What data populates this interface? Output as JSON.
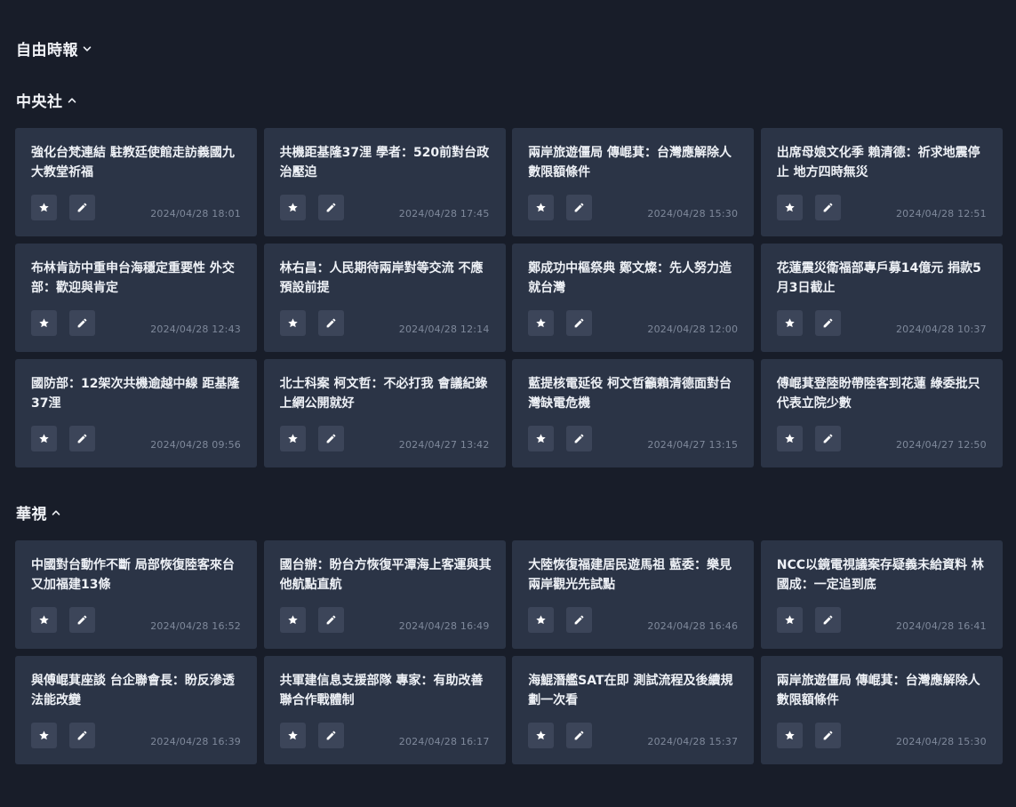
{
  "sections": [
    {
      "title": "自由時報",
      "expanded": false,
      "cards": []
    },
    {
      "title": "中央社",
      "expanded": true,
      "cards": [
        {
          "title": "強化台梵連結 駐教廷使館走訪義國九大教堂祈福",
          "time": "2024/04/28 18:01"
        },
        {
          "title": "共機距基隆37浬 學者：520前對台政治壓迫",
          "time": "2024/04/28 17:45"
        },
        {
          "title": "兩岸旅遊僵局 傳崐萁：台灣應解除人數限額條件",
          "time": "2024/04/28 15:30"
        },
        {
          "title": "出席母娘文化季 賴清德：祈求地震停止 地方四時無災",
          "time": "2024/04/28 12:51"
        },
        {
          "title": "布林肯訪中重申台海穩定重要性 外交部：歡迎與肯定",
          "time": "2024/04/28 12:43"
        },
        {
          "title": "林右昌：人民期待兩岸對等交流 不應預設前提",
          "time": "2024/04/28 12:14"
        },
        {
          "title": "鄭成功中樞祭典 鄭文燦：先人努力造就台灣",
          "time": "2024/04/28 12:00"
        },
        {
          "title": "花蓮震災衛福部專戶募14億元 捐款5月3日截止",
          "time": "2024/04/28 10:37"
        },
        {
          "title": "國防部：12架次共機逾越中線 距基隆37浬",
          "time": "2024/04/28 09:56"
        },
        {
          "title": "北士科案 柯文哲：不必打我 會議紀錄上網公開就好",
          "time": "2024/04/27 13:42"
        },
        {
          "title": "藍提核電延役 柯文哲籲賴清德面對台灣缺電危機",
          "time": "2024/04/27 13:15"
        },
        {
          "title": "傅崐萁登陸盼帶陸客到花蓮 綠委批只代表立院少數",
          "time": "2024/04/27 12:50"
        }
      ]
    },
    {
      "title": "華視",
      "expanded": true,
      "cards": [
        {
          "title": "中國對台動作不斷 局部恢復陸客來台又加福建13條",
          "time": "2024/04/28 16:52"
        },
        {
          "title": "國台辦：盼台方恢復平潭海上客運與其他航點直航",
          "time": "2024/04/28 16:49"
        },
        {
          "title": "大陸恢復福建居民遊馬祖 藍委：樂見兩岸觀光先試點",
          "time": "2024/04/28 16:46"
        },
        {
          "title": "NCC以鏡電視議案存疑義未給資料 林國成：一定追到底",
          "time": "2024/04/28 16:41"
        },
        {
          "title": "與傅崐萁座談 台企聯會長：盼反滲透法能改變",
          "time": "2024/04/28 16:39"
        },
        {
          "title": "共軍建信息支援部隊 專家：有助改善聯合作戰體制",
          "time": "2024/04/28 16:17"
        },
        {
          "title": "海鯤潛艦SAT在即 測試流程及後續規劃一次看",
          "time": "2024/04/28 15:37"
        },
        {
          "title": "兩岸旅遊僵局 傳崐萁：台灣應解除人數限額條件",
          "time": "2024/04/28 15:30"
        }
      ]
    }
  ],
  "icons": {
    "favorite": "star-icon",
    "edit": "pencil-icon",
    "collapse": "chevron-up-icon",
    "expand": "chevron-down-icon"
  },
  "colors": {
    "background": "#181d29",
    "card": "#2b3446",
    "button": "#3c4559",
    "text": "#eef1f6",
    "muted": "#7f899b"
  }
}
